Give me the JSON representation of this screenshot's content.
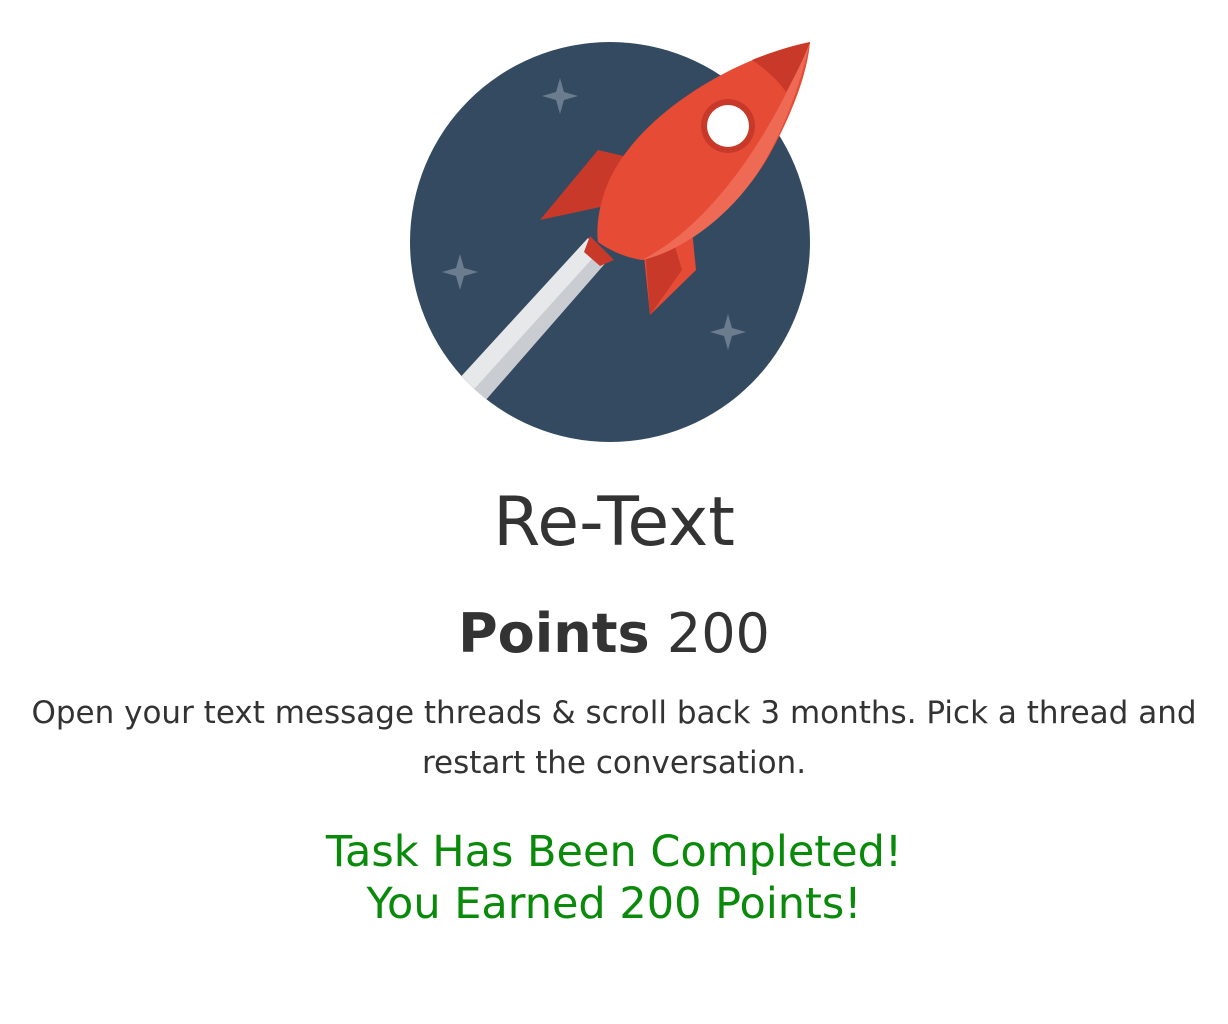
{
  "hero": {
    "icon": "rocket-icon",
    "colors": {
      "circle": "#344a61",
      "rocket": "#e64b36",
      "rocket_shade": "#c8392a",
      "window": "#ffffff",
      "trail": "#e6e8ea",
      "stars": "#6b7c8f"
    }
  },
  "task": {
    "title": "Re-Text",
    "points_label": "Points",
    "points_value": "200",
    "description": "Open your text message threads & scroll back 3 months. Pick a thread and restart the conversation."
  },
  "status": {
    "line1": "Task Has Been Completed!",
    "line2": "You Earned 200 Points!",
    "color": "#0a8a0a"
  }
}
